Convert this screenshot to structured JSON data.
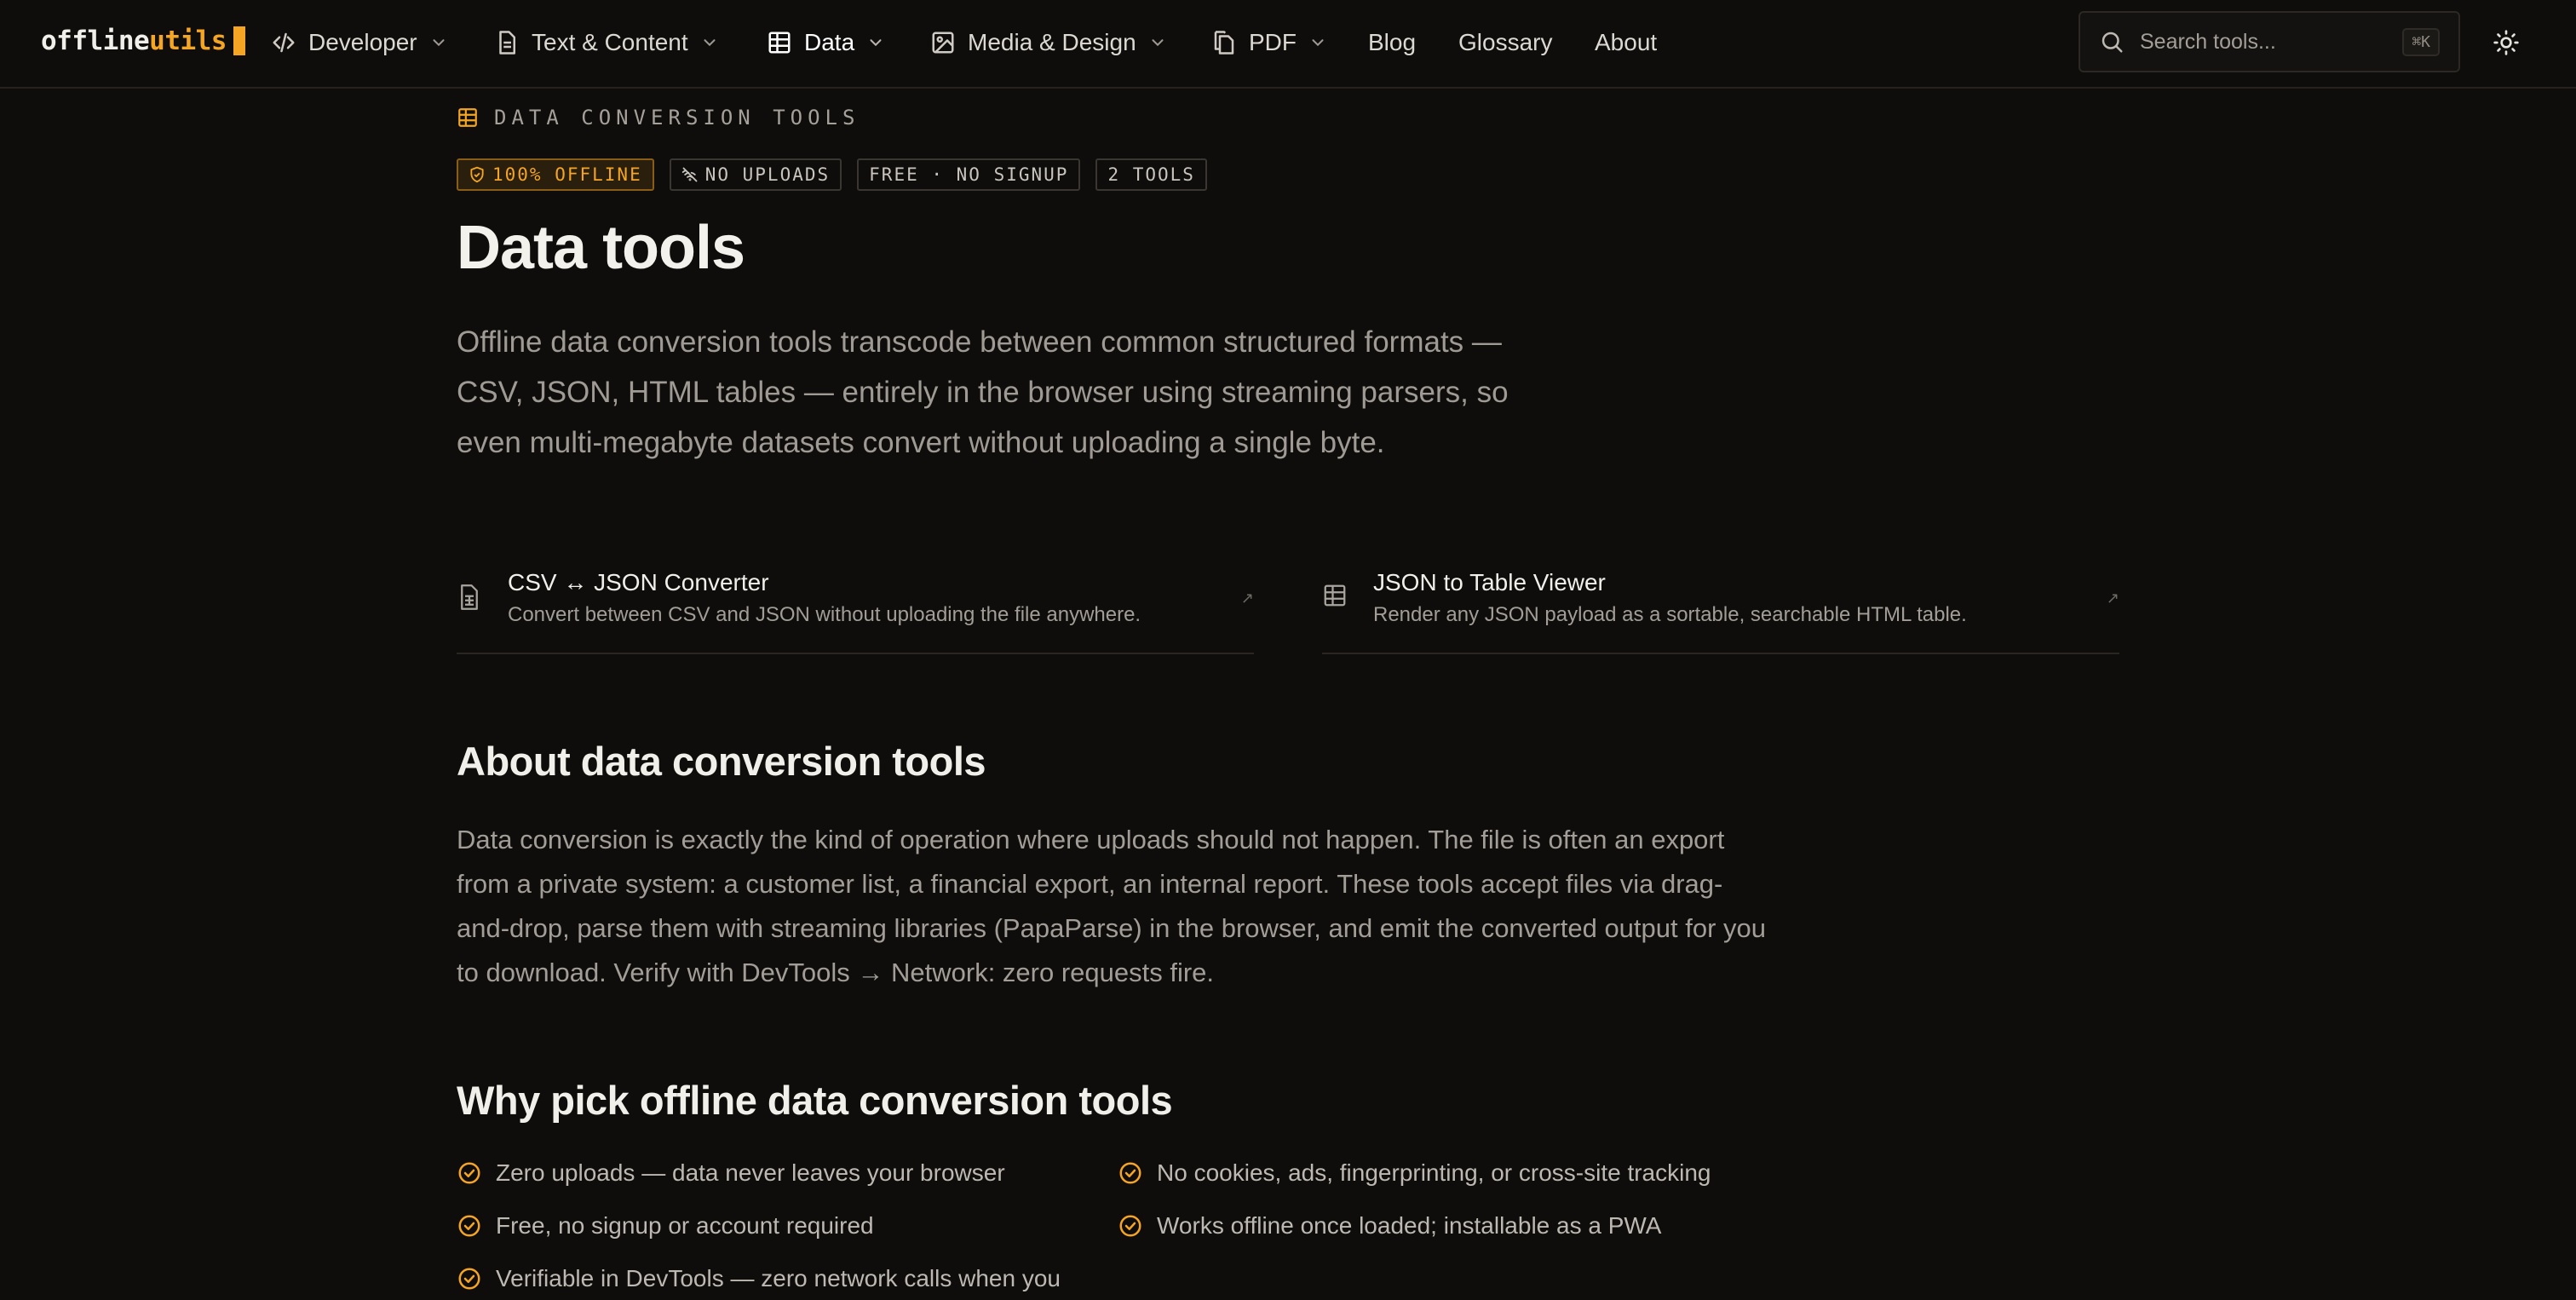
{
  "logo": {
    "part1": "offline",
    "part2": "utils"
  },
  "nav": {
    "items": [
      {
        "label": "Developer",
        "icon": "code-icon",
        "dropdown": true
      },
      {
        "label": "Text & Content",
        "icon": "document-icon",
        "dropdown": true
      },
      {
        "label": "Data",
        "icon": "table-icon",
        "dropdown": true,
        "active": true
      },
      {
        "label": "Media & Design",
        "icon": "image-icon",
        "dropdown": true
      },
      {
        "label": "PDF",
        "icon": "pdf-icon",
        "dropdown": true
      },
      {
        "label": "Blog"
      },
      {
        "label": "Glossary"
      },
      {
        "label": "About"
      }
    ],
    "search": {
      "placeholder": "Search tools...",
      "shortcut": "⌘K"
    },
    "theme_toggle_icon": "sun-icon"
  },
  "hero": {
    "eyebrow": "DATA CONVERSION TOOLS",
    "badges": [
      "100% OFFLINE",
      "NO UPLOADS",
      "FREE · NO SIGNUP",
      "2 TOOLS"
    ],
    "title": "Data tools",
    "lede": "Offline data conversion tools transcode between common structured formats — CSV, JSON, HTML tables — entirely in the browser using streaming parsers, so even multi-megabyte datasets convert without uploading a single byte."
  },
  "tools": [
    {
      "name": "CSV ↔ JSON Converter",
      "description": "Convert between CSV and JSON without uploading the file anywhere.",
      "icon": "spreadsheet-file-icon",
      "arrow": "↗"
    },
    {
      "name": "JSON to Table Viewer",
      "description": "Render any JSON payload as a sortable, searchable HTML table.",
      "icon": "table-icon",
      "arrow": "↗"
    }
  ],
  "about": {
    "heading": "About data conversion tools",
    "text": "Data conversion is exactly the kind of operation where uploads should not happen. The file is often an export from a private system: a customer list, a financial export, an internal report. These tools accept files via drag-and-drop, parse them with streaming libraries (PapaParse) in the browser, and emit the converted output for you to download. Verify with DevTools → Network: zero requests fire."
  },
  "why": {
    "heading": "Why pick offline data conversion tools",
    "items": [
      "Zero uploads — data never leaves your browser",
      "No cookies, ads, fingerprinting, or cross-site tracking",
      "Free, no signup or account required",
      "Works offline once loaded; installable as a PWA",
      "Verifiable in DevTools — zero network calls when you"
    ]
  },
  "colors": {
    "accent": "#f5a524",
    "background": "#0e0d0c",
    "text": "#e8e6e1",
    "muted": "#a29e97"
  }
}
